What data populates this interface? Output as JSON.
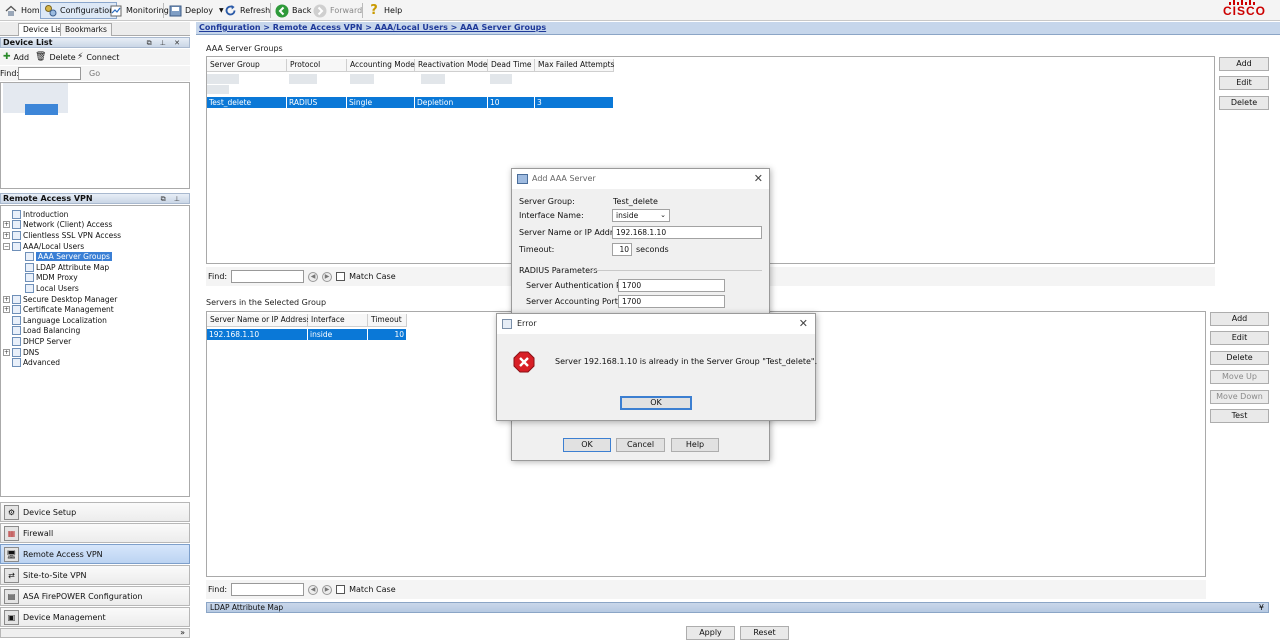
{
  "toolbar": {
    "home": "Home",
    "configuration": "Configuration",
    "monitoring": "Monitoring",
    "deploy": "Deploy",
    "refresh": "Refresh",
    "back": "Back",
    "forward": "Forward",
    "help": "Help",
    "brand": "CISCO"
  },
  "left_tabs": [
    "Device List",
    "Bookmarks"
  ],
  "device_list": {
    "title": "Device List",
    "add": "Add",
    "delete": "Delete",
    "connect": "Connect",
    "find_label": "Find:",
    "go": "Go"
  },
  "vpn_panel": {
    "title": "Remote Access VPN",
    "tree": [
      {
        "label": "Introduction",
        "depth": 0
      },
      {
        "label": "Network (Client) Access",
        "depth": 0
      },
      {
        "label": "Clientless SSL VPN Access",
        "depth": 0
      },
      {
        "label": "AAA/Local Users",
        "depth": 0
      },
      {
        "label": "AAA Server Groups",
        "depth": 1,
        "selected": true
      },
      {
        "label": "LDAP Attribute Map",
        "depth": 1
      },
      {
        "label": "MDM Proxy",
        "depth": 1
      },
      {
        "label": "Local Users",
        "depth": 1
      },
      {
        "label": "Secure Desktop Manager",
        "depth": 0
      },
      {
        "label": "Certificate Management",
        "depth": 0
      },
      {
        "label": "Language Localization",
        "depth": 0
      },
      {
        "label": "Load Balancing",
        "depth": 0
      },
      {
        "label": "DHCP Server",
        "depth": 0
      },
      {
        "label": "DNS",
        "depth": 0
      },
      {
        "label": "Advanced",
        "depth": 0
      }
    ]
  },
  "nav": {
    "device_setup": "Device Setup",
    "firewall": "Firewall",
    "remote_access_vpn": "Remote Access VPN",
    "site_to_site": "Site-to-Site VPN",
    "firepower": "ASA FirePOWER Configuration",
    "device_management": "Device Management",
    "more": "»"
  },
  "breadcrumb": "Configuration > Remote Access VPN > AAA/Local Users > AAA Server Groups",
  "server_groups": {
    "title": "AAA Server Groups",
    "columns": [
      "Server Group",
      "Protocol",
      "Accounting Mode",
      "Reactivation Mode",
      "Dead Time",
      "Max Failed Attempts"
    ],
    "selected_row": [
      "Test_delete",
      "RADIUS",
      "Single",
      "Depletion",
      "10",
      "3"
    ],
    "buttons": {
      "add": "Add",
      "edit": "Edit",
      "delete": "Delete"
    }
  },
  "find": {
    "label": "Find:",
    "match_case": "Match Case"
  },
  "servers": {
    "title": "Servers in the Selected Group",
    "columns": [
      "Server Name or IP Address",
      "Interface",
      "Timeout"
    ],
    "row": [
      "192.168.1.10",
      "inside",
      "10"
    ],
    "buttons": {
      "add": "Add",
      "edit": "Edit",
      "delete": "Delete",
      "move_up": "Move Up",
      "move_down": "Move Down",
      "test": "Test"
    }
  },
  "ldap_bar": "LDAP Attribute Map",
  "bottom": {
    "apply": "Apply",
    "reset": "Reset"
  },
  "add_dialog": {
    "title": "Add AAA Server",
    "server_group_label": "Server Group:",
    "server_group_value": "Test_delete",
    "interface_label": "Interface Name:",
    "interface_value": "inside",
    "address_label": "Server Name or IP Address:",
    "address_value": "192.168.1.10",
    "timeout_label": "Timeout:",
    "timeout_value": "10",
    "timeout_unit": "seconds",
    "radius_section": "RADIUS Parameters",
    "auth_port_label": "Server Authentication Port:",
    "auth_port_value": "1700",
    "acct_port_label": "Server Accounting Port:",
    "acct_port_value": "1700",
    "ok": "OK",
    "cancel": "Cancel",
    "help": "Help"
  },
  "error_dialog": {
    "title": "Error",
    "message": "Server 192.168.1.10 is already in the Server Group \"Test_delete\".",
    "ok": "OK"
  },
  "colors": {
    "selection": "#0a78d7",
    "header": "#c6d6eb",
    "error": "#d81f26"
  }
}
